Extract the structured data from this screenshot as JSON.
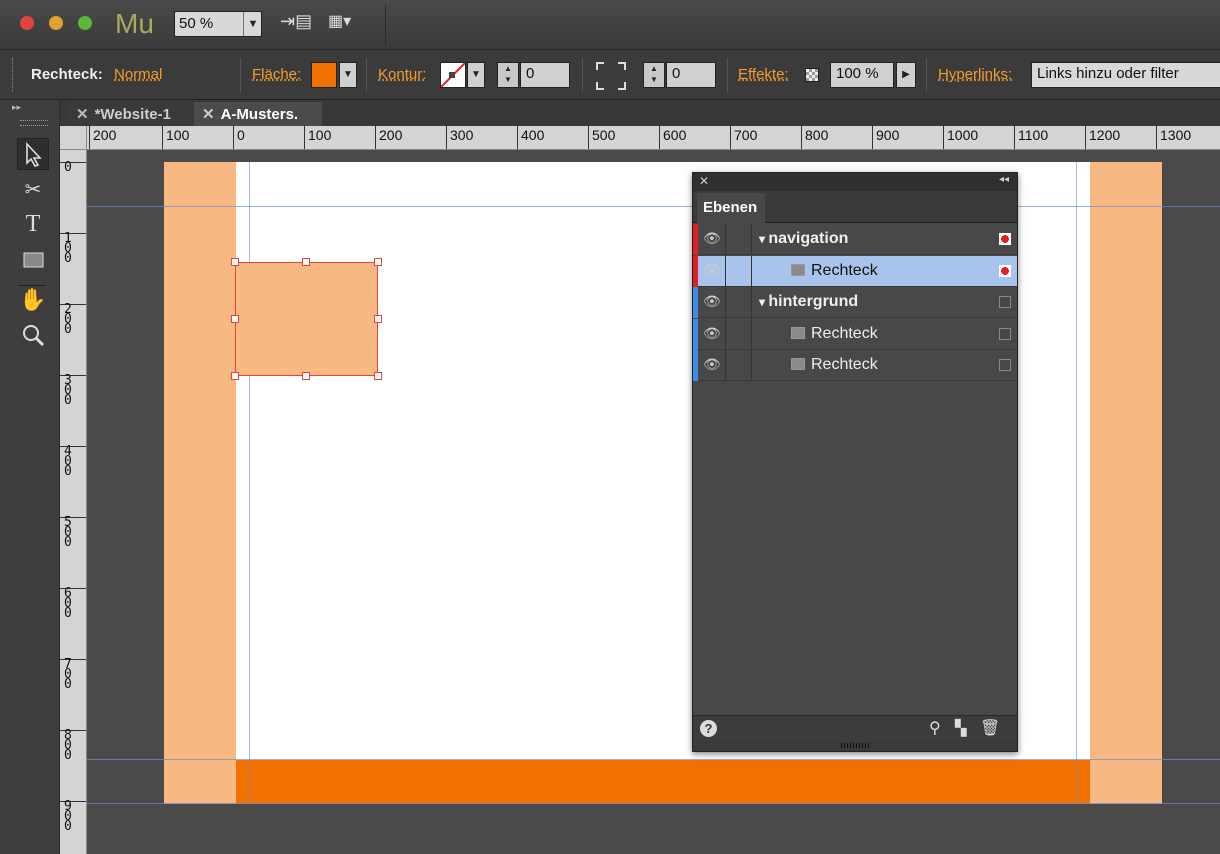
{
  "app": {
    "logo": "Mu",
    "zoom": "50 %"
  },
  "control": {
    "object_label": "Rechteck:",
    "object_state": "Normal",
    "fill_label": "Fläche:",
    "fill_color": "#f07000",
    "stroke_label": "Kontur:",
    "stroke_width": "0",
    "corner_value": "0",
    "effects_label": "Effekte:",
    "opacity": "100 %",
    "hyperlinks_label": "Hyperlinks:",
    "hyperlinks_value": "Links hinzu oder filter"
  },
  "tabs": [
    {
      "label": "*Website-1"
    },
    {
      "label": "A-Musters."
    }
  ],
  "ruler": {
    "h": [
      "200",
      "100",
      "0",
      "100",
      "200",
      "300",
      "400",
      "500",
      "600",
      "700",
      "800",
      "900",
      "1000",
      "1100",
      "1200",
      "1300"
    ],
    "v": [
      "0",
      "1\n0\n0",
      "2\n0\n0",
      "3\n0\n0",
      "4\n0\n0",
      "5\n0\n0",
      "6\n0\n0",
      "7\n0\n0",
      "8\n0\n0",
      "9\n0\n0"
    ]
  },
  "colors": {
    "peach": "#f8b882",
    "orange": "#f07000",
    "selection": "#e8433a",
    "guide": "#6b8cd6",
    "layer_red": "#e02020",
    "layer_blue": "#3a8ee8"
  },
  "panel": {
    "title": "Ebenen",
    "layers": [
      {
        "name": "navigation",
        "type": "group",
        "color": "layer_red",
        "selected": false,
        "marked": true
      },
      {
        "name": "Rechteck",
        "type": "item",
        "color": "layer_red",
        "selected": true,
        "marked": true
      },
      {
        "name": "hintergrund",
        "type": "group",
        "color": "layer_blue",
        "selected": false,
        "marked": false
      },
      {
        "name": "Rechteck",
        "type": "item",
        "color": "layer_blue",
        "selected": false,
        "marked": false
      },
      {
        "name": "Rechteck",
        "type": "item",
        "color": "layer_blue",
        "selected": false,
        "marked": false
      }
    ]
  }
}
